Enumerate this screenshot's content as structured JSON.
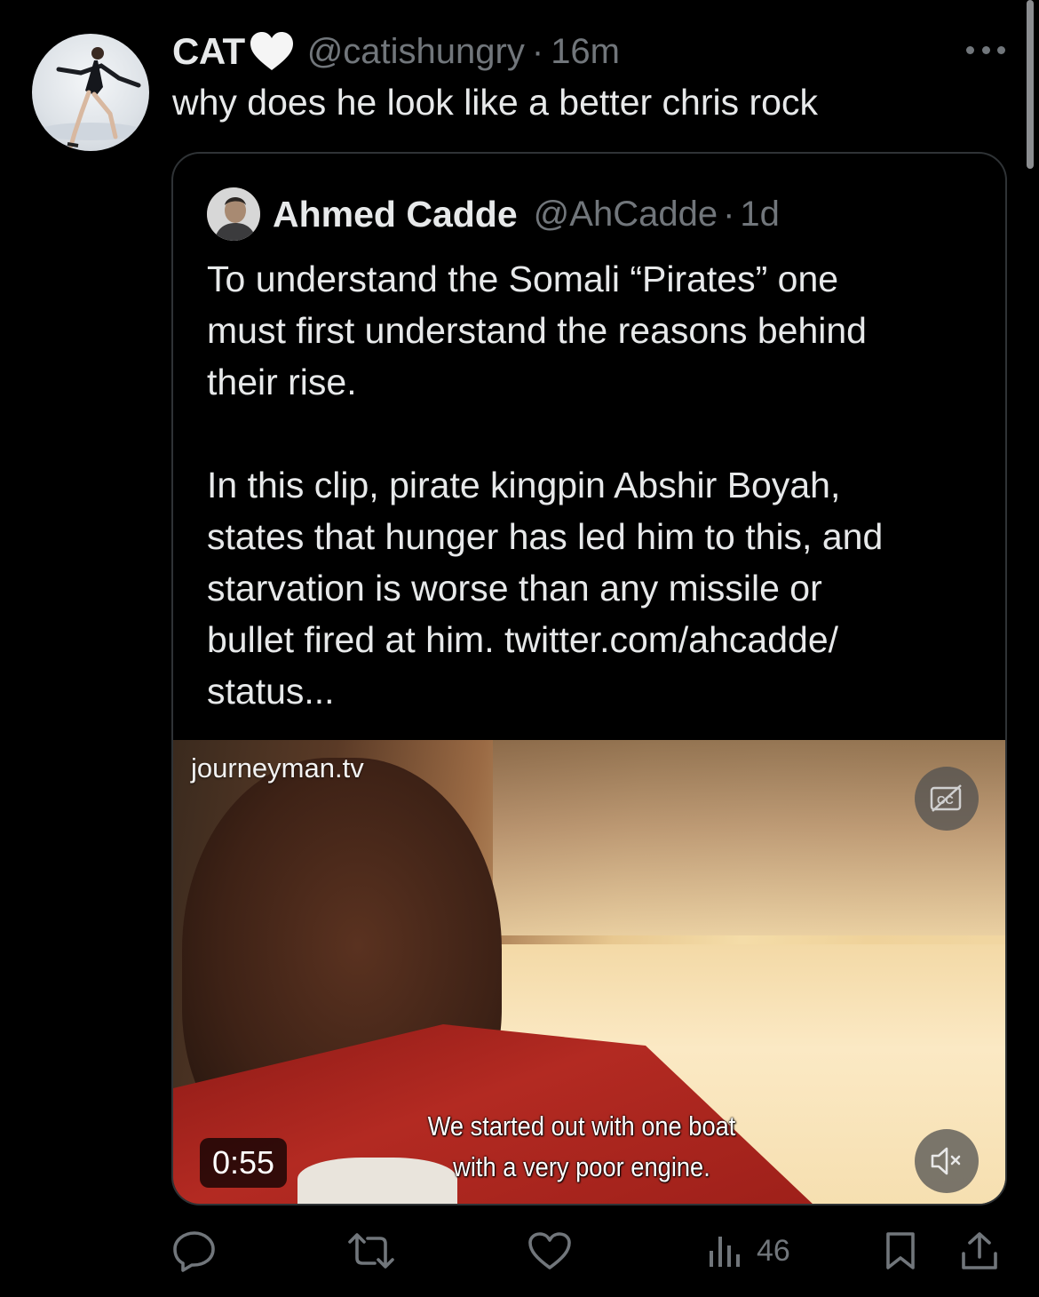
{
  "tweet": {
    "display_name": "CAT",
    "name_badge": "white-heart",
    "handle": "@catishungry",
    "separator": "·",
    "time": "16m",
    "text": "why does he look like a better chris rock"
  },
  "quoted": {
    "display_name": "Ahmed Cadde",
    "handle": "@AhCadde",
    "separator": "·",
    "time": "1d",
    "paragraph1": "To understand the Somali “Pirates” one\nmust first understand the reasons behind\ntheir rise.",
    "paragraph2": "In this clip, pirate kingpin Abshir Boyah,\nstates that hunger has led him to this, and\nstarvation is worse than any missile or\nbullet fired at him. twitter.com/ahcadde/\nstatus...",
    "video": {
      "watermark": "journeyman.tv",
      "subtitle_line1": "We started out with one boat",
      "subtitle_line2": "with a very poor engine.",
      "duration": "0:55",
      "captions_icon": "captions-off-icon",
      "mute_icon": "speaker-muted-icon"
    }
  },
  "actions": {
    "reply_icon": "reply-icon",
    "retweet_icon": "retweet-icon",
    "like_icon": "heart-icon",
    "views_icon": "views-icon",
    "views_count": "46",
    "bookmark_icon": "bookmark-icon",
    "share_icon": "share-icon"
  },
  "colors": {
    "background": "#000000",
    "text_primary": "#e7e9ea",
    "text_secondary": "#71767b",
    "border": "#2f3336"
  }
}
